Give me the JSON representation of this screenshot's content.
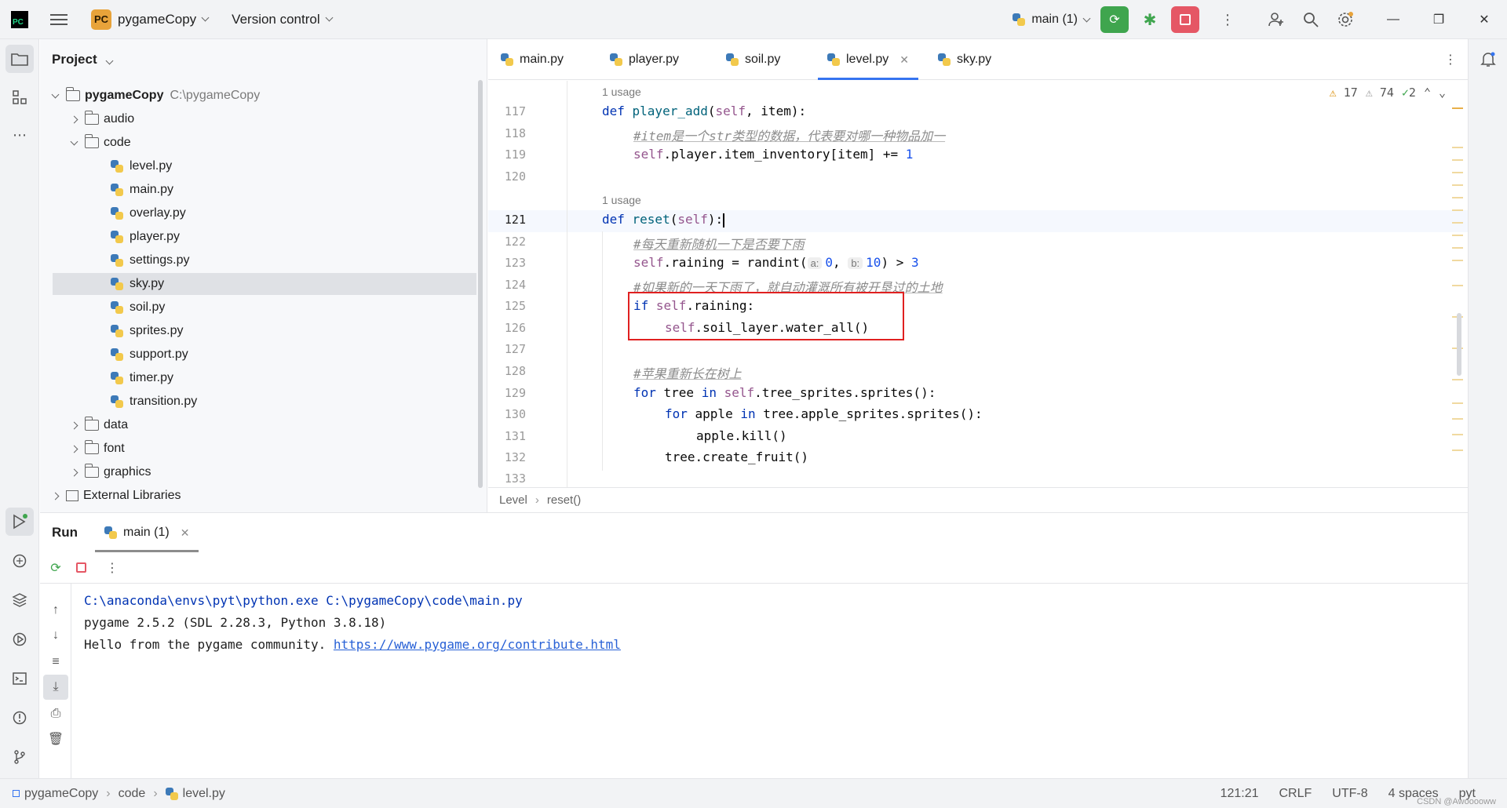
{
  "titlebar": {
    "project_badge": "PC",
    "project_name": "pygameCopy",
    "vcs_label": "Version control",
    "run_config": "main (1)"
  },
  "project_panel": {
    "title": "Project",
    "root_name": "pygameCopy",
    "root_path": "C:\\pygameCopy",
    "items": [
      {
        "name": "audio",
        "type": "folder"
      },
      {
        "name": "code",
        "type": "folder"
      },
      {
        "name": "level.py",
        "type": "file"
      },
      {
        "name": "main.py",
        "type": "file"
      },
      {
        "name": "overlay.py",
        "type": "file"
      },
      {
        "name": "player.py",
        "type": "file"
      },
      {
        "name": "settings.py",
        "type": "file"
      },
      {
        "name": "sky.py",
        "type": "file"
      },
      {
        "name": "soil.py",
        "type": "file"
      },
      {
        "name": "sprites.py",
        "type": "file"
      },
      {
        "name": "support.py",
        "type": "file"
      },
      {
        "name": "timer.py",
        "type": "file"
      },
      {
        "name": "transition.py",
        "type": "file"
      },
      {
        "name": "data",
        "type": "folder"
      },
      {
        "name": "font",
        "type": "folder"
      },
      {
        "name": "graphics",
        "type": "folder"
      }
    ],
    "external_libraries": "External Libraries"
  },
  "tabs": [
    "main.py",
    "player.py",
    "soil.py",
    "level.py",
    "sky.py"
  ],
  "inspections": {
    "warnings": "17",
    "weak_warnings": "74",
    "typos": "2"
  },
  "editor": {
    "usage_label": "1 usage",
    "line_numbers": [
      "117",
      "118",
      "119",
      "120",
      "121",
      "122",
      "123",
      "124",
      "125",
      "126",
      "127",
      "128",
      "129",
      "130",
      "131",
      "132",
      "133"
    ],
    "lines": {
      "l117_def": "def ",
      "l117_fn": "player_add",
      "l117_open": "(",
      "l117_self": "self",
      "l117_rest": ", item):",
      "l118": "#item是一个str类型的数据，代表要对哪一种物品加一",
      "l119_self": "self",
      "l119_rest": ".player.item_inventory[item] += ",
      "l119_num": "1",
      "l121_def": "def ",
      "l121_fn": "reset",
      "l121_open": "(",
      "l121_self": "self",
      "l121_rest": "):",
      "l122": "#每天重新随机一下是否要下雨",
      "l123_self": "self",
      "l123_a": ".raining = randint(",
      "l123_hint_a": "a:",
      "l123_num_a": "0",
      "l123_comma": ",",
      "l123_hint_b": "b:",
      "l123_num_b": "10",
      "l123_gt": ") > ",
      "l123_num_c": "3",
      "l124": "#如果新的一天下雨了，就自动灌溉所有被开垦过的土地",
      "l125_if": "if ",
      "l125_self": "self",
      "l125_rest": ".raining:",
      "l126_self": "self",
      "l126_rest": ".soil_layer.water_all()",
      "l128": "#苹果重新长在树上",
      "l129_for": "for ",
      "l129_mid": "tree ",
      "l129_in": "in ",
      "l129_self": "self",
      "l129_rest": ".tree_sprites.sprites():",
      "l130_for": "for ",
      "l130_mid": "apple ",
      "l130_in": "in ",
      "l130_rest": "tree.apple_sprites.sprites():",
      "l131": "apple.kill()",
      "l132": "tree.create_fruit()"
    }
  },
  "editor_breadcrumb": [
    "Level",
    "reset()"
  ],
  "run_panel": {
    "title": "Run",
    "tab": "main (1)",
    "console": [
      "C:\\anaconda\\envs\\pyt\\python.exe C:\\pygameCopy\\code\\main.py",
      "pygame 2.5.2 (SDL 2.28.3, Python 3.8.18)",
      "Hello from the pygame community. "
    ],
    "console_link": "https://www.pygame.org/contribute.html"
  },
  "statusbar": {
    "breadcrumb": [
      "pygameCopy",
      "code",
      "level.py"
    ],
    "position": "121:21",
    "line_sep": "CRLF",
    "encoding": "UTF-8",
    "indent": "4 spaces",
    "interpreter": "pyt"
  },
  "watermark": "CSDN @Awooooww"
}
